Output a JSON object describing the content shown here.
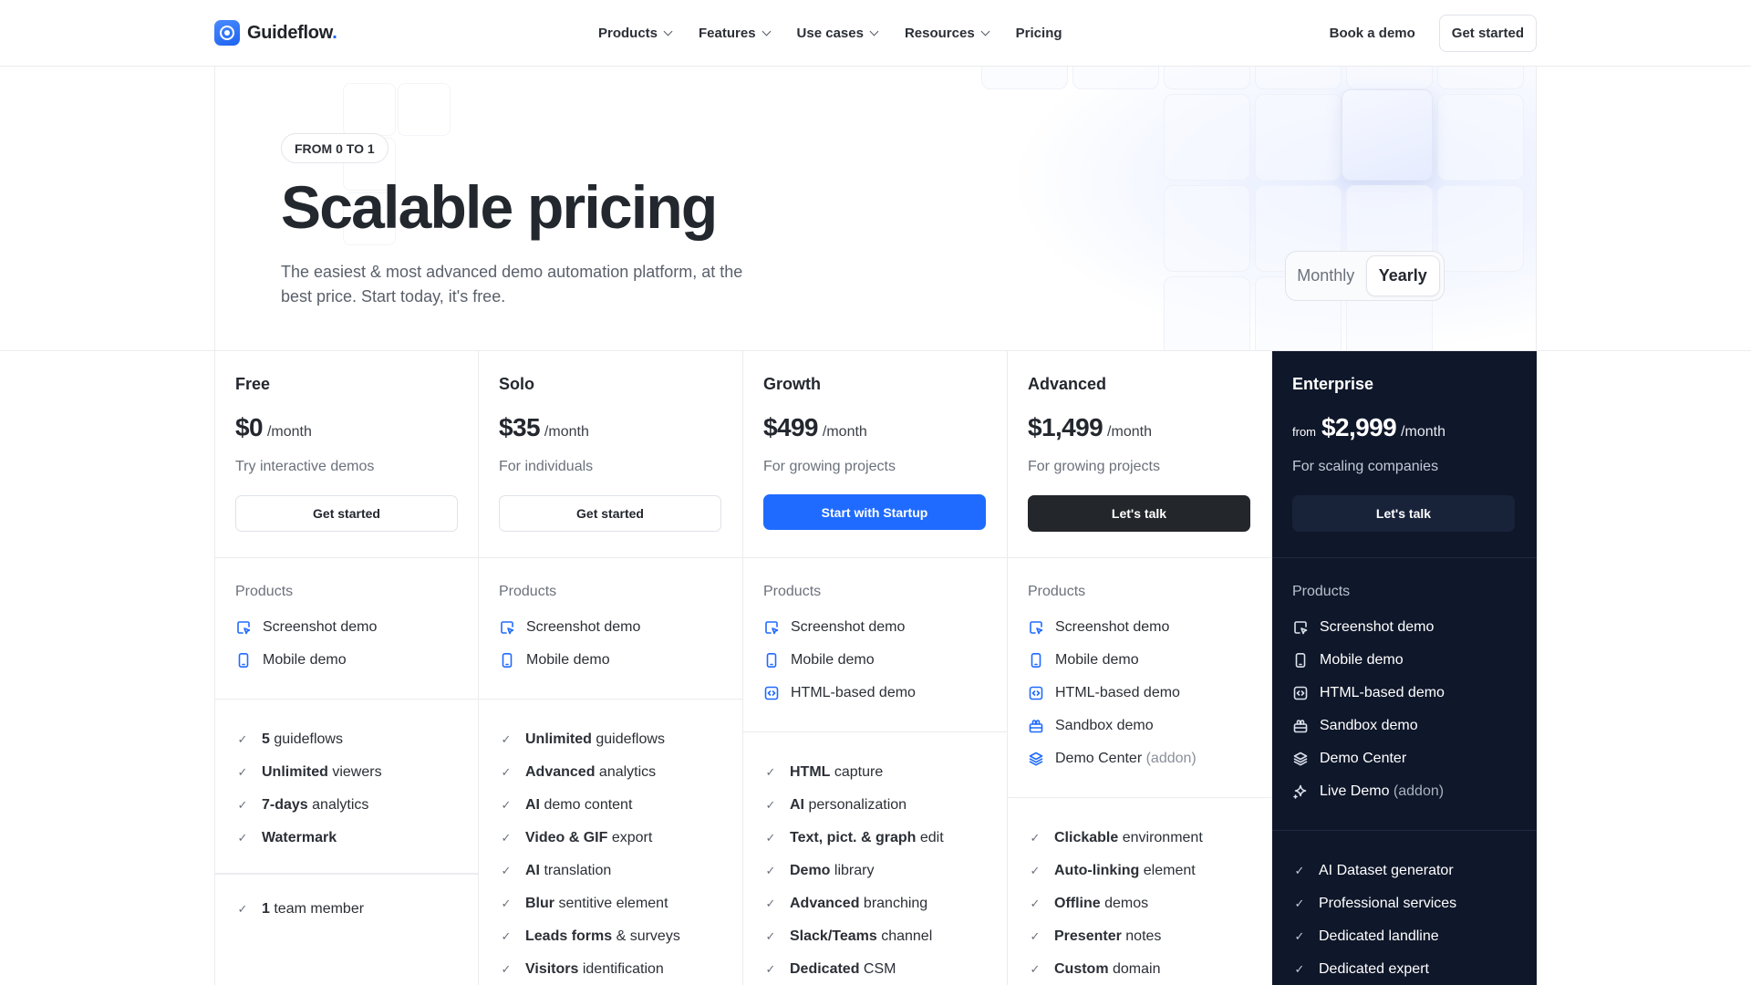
{
  "nav": {
    "logo_text": "Guideflow",
    "logo_dot": ".",
    "menu": [
      {
        "label": "Products",
        "has_dropdown": true
      },
      {
        "label": "Features",
        "has_dropdown": true
      },
      {
        "label": "Use cases",
        "has_dropdown": true
      },
      {
        "label": "Resources",
        "has_dropdown": true
      },
      {
        "label": "Pricing",
        "has_dropdown": false
      }
    ],
    "book_demo": "Book a demo",
    "get_started": "Get started"
  },
  "hero": {
    "badge": "FROM 0 TO 1",
    "title": "Scalable pricing",
    "subtitle": "The easiest & most advanced demo automation platform, at the best price. Start today, it's free.",
    "toggle": {
      "monthly": "Monthly",
      "yearly": "Yearly",
      "selected": "Yearly"
    }
  },
  "plans": [
    {
      "name": "Free",
      "from": "",
      "price": "$0",
      "per": "/month",
      "desc": "Try interactive demos",
      "cta": "Get started",
      "cta_style": "outline",
      "products_title": "Products",
      "products": [
        {
          "label": "Screenshot demo",
          "addon": "",
          "icon": "screenshot-icon"
        },
        {
          "label": "Mobile demo",
          "addon": "",
          "icon": "mobile-icon"
        }
      ],
      "features": [
        {
          "bold": "5",
          "rest": " guideflows"
        },
        {
          "bold": "Unlimited",
          "rest": " viewers"
        },
        {
          "bold": "7-days",
          "rest": " analytics"
        },
        {
          "bold": "Watermark",
          "rest": ""
        }
      ],
      "team": [
        {
          "bold": "1",
          "rest": " team member"
        }
      ]
    },
    {
      "name": "Solo",
      "from": "",
      "price": "$35",
      "per": "/month",
      "desc": "For individuals",
      "cta": "Get started",
      "cta_style": "outline",
      "products_title": "Products",
      "products": [
        {
          "label": "Screenshot demo",
          "addon": "",
          "icon": "screenshot-icon"
        },
        {
          "label": "Mobile demo",
          "addon": "",
          "icon": "mobile-icon"
        }
      ],
      "features": [
        {
          "bold": "Unlimited",
          "rest": " guideflows"
        },
        {
          "bold": "Advanced",
          "rest": " analytics"
        },
        {
          "bold": "AI",
          "rest": " demo content"
        },
        {
          "bold": "Video & GIF",
          "rest": " export"
        },
        {
          "bold": "AI",
          "rest": " translation"
        },
        {
          "bold": "Blur",
          "rest": " sentitive element"
        },
        {
          "bold": "Leads forms",
          "rest": " & surveys"
        },
        {
          "bold": "Visitors",
          "rest": " identification"
        }
      ],
      "team": []
    },
    {
      "name": "Growth",
      "from": "",
      "price": "$499",
      "per": "/month",
      "desc": "For growing projects",
      "cta": "Start with Startup",
      "cta_style": "blue",
      "products_title": "Products",
      "products": [
        {
          "label": "Screenshot demo",
          "addon": "",
          "icon": "screenshot-icon"
        },
        {
          "label": "Mobile demo",
          "addon": "",
          "icon": "mobile-icon"
        },
        {
          "label": "HTML-based demo",
          "addon": "",
          "icon": "html-icon"
        }
      ],
      "features": [
        {
          "bold": "HTML",
          "rest": " capture"
        },
        {
          "bold": "AI",
          "rest": " personalization"
        },
        {
          "bold": "Text, pict. & graph",
          "rest": " edit"
        },
        {
          "bold": "Demo",
          "rest": " library"
        },
        {
          "bold": "Advanced",
          "rest": " branching"
        },
        {
          "bold": "Slack/Teams",
          "rest": " channel"
        },
        {
          "bold": "Dedicated",
          "rest": " CSM"
        }
      ],
      "team": []
    },
    {
      "name": "Advanced",
      "from": "",
      "price": "$1,499",
      "per": "/month",
      "desc": "For growing projects",
      "cta": "Let's talk",
      "cta_style": "black",
      "products_title": "Products",
      "products": [
        {
          "label": "Screenshot demo",
          "addon": "",
          "icon": "screenshot-icon"
        },
        {
          "label": "Mobile demo",
          "addon": "",
          "icon": "mobile-icon"
        },
        {
          "label": "HTML-based demo",
          "addon": "",
          "icon": "html-icon"
        },
        {
          "label": "Sandbox demo",
          "addon": "",
          "icon": "sandbox-icon"
        },
        {
          "label": "Demo Center",
          "addon": " (addon)",
          "icon": "layers-icon"
        }
      ],
      "features": [
        {
          "bold": "Clickable",
          "rest": " environment"
        },
        {
          "bold": "Auto-linking",
          "rest": " element"
        },
        {
          "bold": "Offline",
          "rest": " demos"
        },
        {
          "bold": "Presenter",
          "rest": " notes"
        },
        {
          "bold": "Custom",
          "rest": " domain"
        }
      ],
      "team": []
    },
    {
      "name": "Enterprise",
      "from": "from",
      "price": "$2,999",
      "per": "/month",
      "desc": "For scaling companies",
      "cta": "Let's talk",
      "cta_style": "navy",
      "products_title": "Products",
      "products": [
        {
          "label": "Screenshot demo",
          "addon": "",
          "icon": "screenshot-icon"
        },
        {
          "label": "Mobile demo",
          "addon": "",
          "icon": "mobile-icon"
        },
        {
          "label": "HTML-based demo",
          "addon": "",
          "icon": "html-icon"
        },
        {
          "label": "Sandbox demo",
          "addon": "",
          "icon": "sandbox-icon"
        },
        {
          "label": "Demo Center",
          "addon": "",
          "icon": "layers-icon"
        },
        {
          "label": "Live Demo",
          "addon": " (addon)",
          "icon": "sparkle-icon"
        }
      ],
      "features": [
        {
          "bold": "",
          "rest": "AI Dataset generator"
        },
        {
          "bold": "",
          "rest": "Professional services"
        },
        {
          "bold": "",
          "rest": "Dedicated landline"
        },
        {
          "bold": "",
          "rest": "Dedicated expert"
        }
      ],
      "team": []
    }
  ],
  "colors": {
    "brand_blue": "#1f6bff",
    "enterprise_bg": "#0f172a",
    "advanced_btn": "#23262b",
    "products_icon": "#1f6bff"
  }
}
